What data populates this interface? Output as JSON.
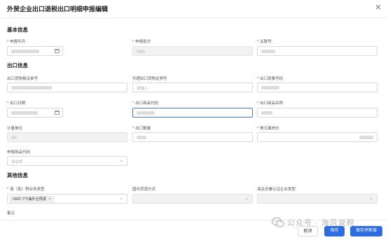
{
  "dialog": {
    "title": "外贸企业出口退税出口明细申报编辑",
    "close_glyph": "✕"
  },
  "sections": {
    "basic": "基本信息",
    "export": "出口信息",
    "other": "其他信息"
  },
  "basic": {
    "period_label": "申报年月",
    "batch_label": "申报批次",
    "serial_label": "关联号"
  },
  "export": {
    "customs_no_label": "出口货物报关单号",
    "agent_cert_label": "代理出口货物证明号",
    "agent_cert_placeholder": "请输入",
    "invoice_label": "出口发票号码",
    "date_label": "出口日期",
    "goods_code_label": "出口商品代码",
    "goods_name_label": "出口商品名称",
    "unit_label": "计量单位",
    "quantity_label": "出口数量",
    "usd_price_label": "美元离岸价",
    "declare_code_label": "申报商品代码",
    "declare_code_placeholder": "请选择"
  },
  "other": {
    "refund_type_label": "退（免）税业务类型",
    "refund_type_tag": "HWC-YT|海外仓预退",
    "tag_remove_glyph": "✕",
    "source_label": "国内货源方式",
    "customs_cert_label": "海关总署认证企业类型",
    "remark_label": "备注"
  },
  "footer": {
    "cancel": "取消",
    "save": "保存",
    "save_new": "保存并新增"
  },
  "watermark": {
    "text": "公众号 · 海风说税"
  },
  "icons": {
    "calendar": "calendar-icon",
    "chevron": "chevron-down-icon",
    "wechat": "wechat-icon"
  },
  "colors": {
    "primary": "#2f6ce0",
    "required": "#f5222d",
    "focus": "#4a78e0"
  }
}
